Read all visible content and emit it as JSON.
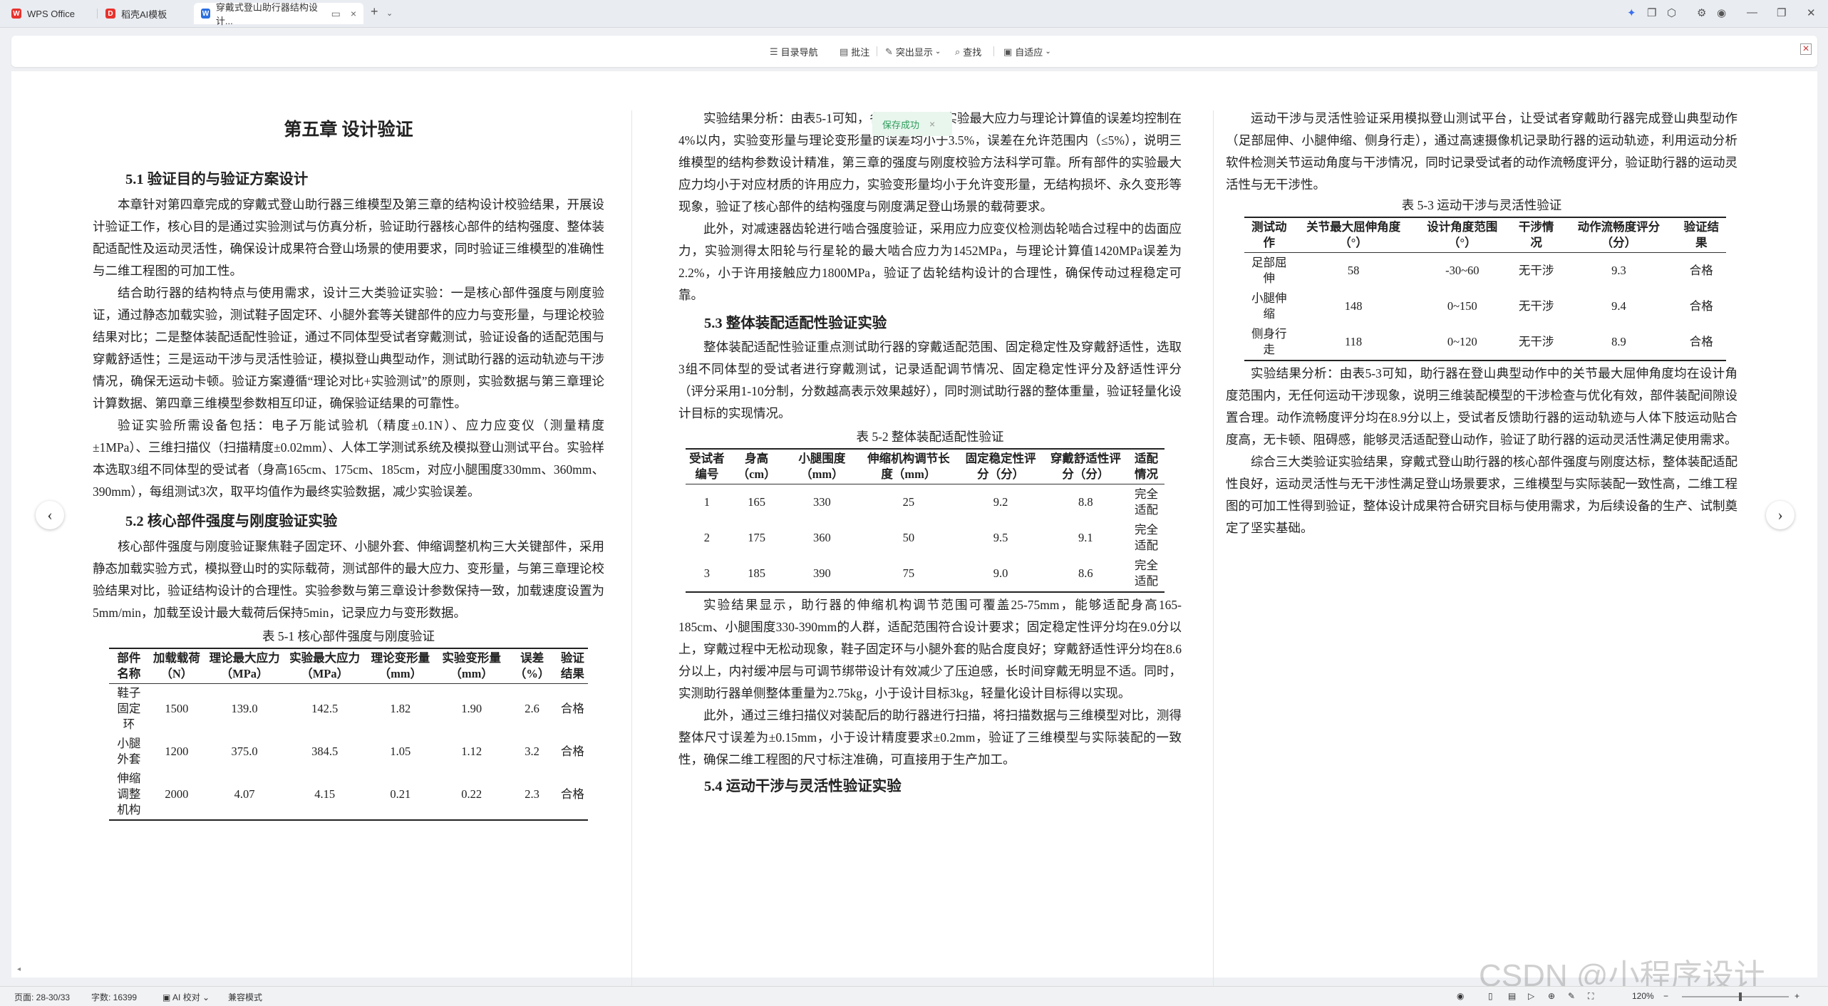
{
  "tabs": [
    {
      "label": "WPS Office"
    },
    {
      "label": "稻壳AI模板"
    },
    {
      "label": "穿戴式登山助行器结构设计..."
    }
  ],
  "toolbar": {
    "nav": "目录导航",
    "comment": "批注",
    "highlight": "突出显示",
    "find": "查找",
    "fit": "自适应"
  },
  "toast": "保存成功",
  "col1": {
    "chapter": "第五章  设计验证",
    "s51": "5.1  验证目的与验证方案设计",
    "p1": "本章针对第四章完成的穿戴式登山助行器三维模型及第三章的结构设计校验结果，开展设计验证工作，核心目的是通过实验测试与仿真分析，验证助行器核心部件的结构强度、整体装配适配性及运动灵活性，确保设计成果符合登山场景的使用要求，同时验证三维模型的准确性与二维工程图的可加工性。",
    "p2": "结合助行器的结构特点与使用需求，设计三大类验证实验：一是核心部件强度与刚度验证，通过静态加载实验，测试鞋子固定环、小腿外套等关键部件的应力与变形量，与理论校验结果对比；二是整体装配适配性验证，通过不同体型受试者穿戴测试，验证设备的适配范围与穿戴舒适性；三是运动干涉与灵活性验证，模拟登山典型动作，测试助行器的运动轨迹与干涉情况，确保无运动卡顿。验证方案遵循“理论对比+实验测试”的原则，实验数据与第三章理论计算数据、第四章三维模型参数相互印证，确保验证结果的可靠性。",
    "p3": "验证实验所需设备包括：电子万能试验机（精度±0.1N）、应力应变仪（测量精度±1MPa）、三维扫描仪（扫描精度±0.02mm）、人体工学测试系统及模拟登山测试平台。实验样本选取3组不同体型的受试者（身高165cm、175cm、185cm，对应小腿围度330mm、360mm、390mm），每组测试3次，取平均值作为最终实验数据，减少实验误差。",
    "s52": "5.2  核心部件强度与刚度验证实验",
    "p4": "核心部件强度与刚度验证聚焦鞋子固定环、小腿外套、伸缩调整机构三大关键部件，采用静态加载实验方式，模拟登山时的实际载荷，测试部件的最大应力、变形量，与第三章理论校验结果对比，验证结构设计的合理性。实验参数与第三章设计参数保持一致，加载速度设置为5mm/min，加载至设计最大载荷后保持5min，记录应力与变形数据。",
    "cap1": "表 5-1  核心部件强度与刚度验证",
    "t1h": [
      "部件名称",
      "加载载荷（N）",
      "理论最大应力（MPa）",
      "实验最大应力（MPa）",
      "理论变形量（mm）",
      "实验变形量（mm）",
      "误差（%）",
      "验证结果"
    ],
    "t1": [
      [
        "鞋子固定环",
        "1500",
        "139.0",
        "142.5",
        "1.82",
        "1.90",
        "2.6",
        "合格"
      ],
      [
        "小腿外套",
        "1200",
        "375.0",
        "384.5",
        "1.05",
        "1.12",
        "3.2",
        "合格"
      ],
      [
        "伸缩调整机构",
        "2000",
        "4.07",
        "4.15",
        "0.21",
        "0.22",
        "2.3",
        "合格"
      ]
    ]
  },
  "col2": {
    "p1": "实验结果分析：由表5-1可知，各核心部件的实验最大应力与理论计算值的误差均控制在4%以内，实验变形量与理论变形量的误差均小于3.5%，误差在允许范围内（≤5%），说明三维模型的结构参数设计精准，第三章的强度与刚度校验方法科学可靠。所有部件的实验最大应力均小于对应材质的许用应力，实验变形量均小于允许变形量，无结构损坏、永久变形等现象，验证了核心部件的结构强度与刚度满足登山场景的载荷要求。",
    "p2": "此外，对减速器齿轮进行啮合强度验证，采用应力应变仪检测齿轮啮合过程中的齿面应力，实验测得太阳轮与行星轮的最大啮合应力为1452MPa，与理论计算值1420MPa误差为2.2%，小于许用接触应力1800MPa，验证了齿轮结构设计的合理性，确保传动过程稳定可靠。",
    "s53": "5.3  整体装配适配性验证实验",
    "p3": "整体装配适配性验证重点测试助行器的穿戴适配范围、固定稳定性及穿戴舒适性，选取3组不同体型的受试者进行穿戴测试，记录适配调节情况、固定稳定性评分及舒适性评分（评分采用1-10分制，分数越高表示效果越好），同时测试助行器的整体重量，验证轻量化设计目标的实现情况。",
    "cap2": "表 5-2  整体装配适配性验证",
    "t2h": [
      "受试者编号",
      "身高（cm）",
      "小腿围度（mm）",
      "伸缩机构调节长度（mm）",
      "固定稳定性评分（分）",
      "穿戴舒适性评分（分）",
      "适配情况"
    ],
    "t2": [
      [
        "1",
        "165",
        "330",
        "25",
        "9.2",
        "8.8",
        "完全适配"
      ],
      [
        "2",
        "175",
        "360",
        "50",
        "9.5",
        "9.1",
        "完全适配"
      ],
      [
        "3",
        "185",
        "390",
        "75",
        "9.0",
        "8.6",
        "完全适配"
      ]
    ],
    "p4": "实验结果显示，助行器的伸缩机构调节范围可覆盖25-75mm，能够适配身高165-185cm、小腿围度330-390mm的人群，适配范围符合设计要求；固定稳定性评分均在9.0分以上，穿戴过程中无松动现象，鞋子固定环与小腿外套的贴合度良好；穿戴舒适性评分均在8.6分以上，内衬缓冲层与可调节绑带设计有效减少了压迫感，长时间穿戴无明显不适。同时，实测助行器单侧整体重量为2.75kg，小于设计目标3kg，轻量化设计目标得以实现。",
    "p5": "此外，通过三维扫描仪对装配后的助行器进行扫描，将扫描数据与三维模型对比，测得整体尺寸误差为±0.15mm，小于设计精度要求±0.2mm，验证了三维模型与实际装配的一致性，确保二维工程图的尺寸标注准确，可直接用于生产加工。",
    "s54": "5.4  运动干涉与灵活性验证实验"
  },
  "col3": {
    "p1": "运动干涉与灵活性验证采用模拟登山测试平台，让受试者穿戴助行器完成登山典型动作（足部屈伸、小腿伸缩、侧身行走），通过高速摄像机记录助行器的运动轨迹，利用运动分析软件检测关节运动角度与干涉情况，同时记录受试者的动作流畅度评分，验证助行器的运动灵活性与无干涉性。",
    "cap3": "表 5-3  运动干涉与灵活性验证",
    "t3h": [
      "测试动作",
      "关节最大屈伸角度（°）",
      "设计角度范围（°）",
      "干涉情况",
      "动作流畅度评分（分）",
      "验证结果"
    ],
    "t3": [
      [
        "足部屈伸",
        "58",
        "-30~60",
        "无干涉",
        "9.3",
        "合格"
      ],
      [
        "小腿伸缩",
        "148",
        "0~150",
        "无干涉",
        "9.4",
        "合格"
      ],
      [
        "侧身行走",
        "118",
        "0~120",
        "无干涉",
        "8.9",
        "合格"
      ]
    ],
    "p2": "实验结果分析：由表5-3可知，助行器在登山典型动作中的关节最大屈伸角度均在设计角度范围内，无任何运动干涉现象，说明三维装配模型的干涉检查与优化有效，部件装配间隙设置合理。动作流畅度评分均在8.9分以上，受试者反馈助行器的运动轨迹与人体下肢运动贴合度高，无卡顿、阻碍感，能够灵活适配登山动作，验证了助行器的运动灵活性满足使用需求。",
    "p3": "综合三大类验证实验结果，穿戴式登山助行器的核心部件强度与刚度达标，整体装配适配性良好，运动灵活性与无干涉性满足登山场景要求，三维模型与实际装配一致性高，二维工程图的可加工性得到验证，整体设计成果符合研究目标与使用需求，为后续设备的生产、试制奠定了坚实基础。"
  },
  "status": {
    "page": "页面: 28-30/33",
    "words": "字数: 16399",
    "ai": "AI 校对",
    "mode": "兼容模式",
    "zoom": "120%"
  },
  "watermark": "CSDN @小程序设计"
}
